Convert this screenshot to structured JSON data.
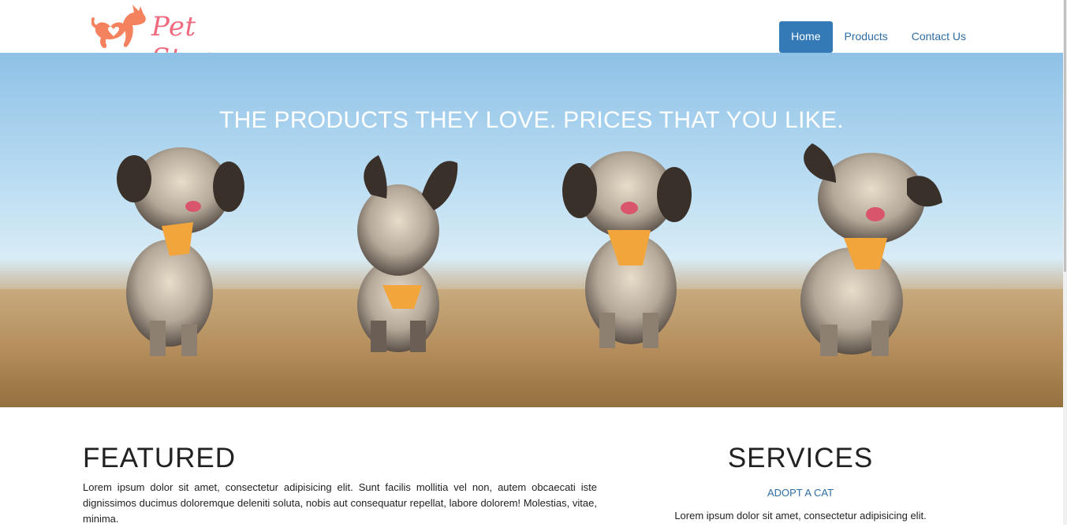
{
  "brand": {
    "name": "Pet Store",
    "logo_icon": "dog-heart-icon",
    "color": "#f06a7f",
    "icon_color": "#f5825f"
  },
  "nav": {
    "items": [
      {
        "label": "Home",
        "active": true
      },
      {
        "label": "Products",
        "active": false
      },
      {
        "label": "Contact Us",
        "active": false
      }
    ],
    "active_color": "#337ab7"
  },
  "hero": {
    "title": "THE PRODUCTS THEY LOVE. PRICES THAT YOU LIKE."
  },
  "featured": {
    "heading": "FEATURED",
    "text": "Lorem ipsum dolor sit amet, consectetur adipisicing elit. Sunt facilis mollitia vel non, autem obcaecati iste dignissimos ducimus doloremque deleniti soluta, nobis aut consequatur repellat, labore dolorem! Molestias, vitae, minima."
  },
  "services": {
    "heading": "SERVICES",
    "link": "ADOPT A CAT",
    "text": "Lorem ipsum dolor sit amet, consectetur adipisicing elit."
  }
}
